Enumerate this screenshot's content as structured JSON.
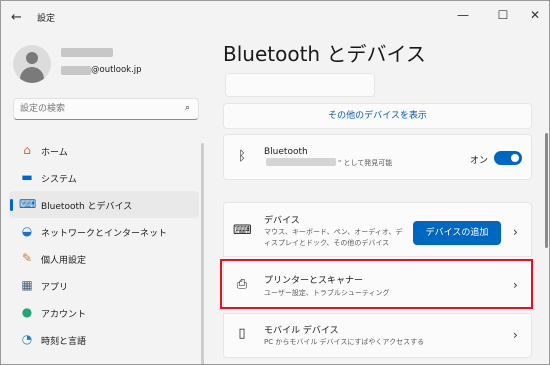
{
  "window": {
    "title": "設定",
    "minimize": "—",
    "maximize": "☐",
    "close": "✕",
    "back": "←"
  },
  "user": {
    "email_suffix": "@outlook.jp"
  },
  "search": {
    "placeholder": "設定の検索"
  },
  "sidebar": {
    "items": [
      {
        "label": "ホーム",
        "icon": "home-icon",
        "color": "#c76b3a",
        "selected": false
      },
      {
        "label": "システム",
        "icon": "system-icon",
        "color": "#0067c0",
        "selected": false
      },
      {
        "label": "Bluetooth とデバイス",
        "icon": "bluetooth-devices-icon",
        "color": "#0067c0",
        "selected": true
      },
      {
        "label": "ネットワークとインターネット",
        "icon": "wifi-icon",
        "color": "#1a73c8",
        "selected": false
      },
      {
        "label": "個人用設定",
        "icon": "brush-icon",
        "color": "#d07a2b",
        "selected": false
      },
      {
        "label": "アプリ",
        "icon": "apps-icon",
        "color": "#4a5b7a",
        "selected": false
      },
      {
        "label": "アカウント",
        "icon": "account-icon",
        "color": "#21a67a",
        "selected": false
      },
      {
        "label": "時刻と言語",
        "icon": "time-language-icon",
        "color": "#1f7fc8",
        "selected": false
      }
    ]
  },
  "main": {
    "title": "Bluetooth とデバイス",
    "more_devices_link": "その他のデバイスを表示",
    "bluetooth": {
      "title": "Bluetooth",
      "subtitle_suffix": "\" として発見可能",
      "toggle_label": "オン",
      "toggle_on": true
    },
    "devices": {
      "title": "デバイス",
      "subtitle": "マウス、キーボード、ペン、オーディオ、ディスプレイとドック、その他のデバイス",
      "add_button": "デバイスの追加"
    },
    "printers": {
      "title": "プリンターとスキャナー",
      "subtitle": "ユーザー設定、トラブルシューティング"
    },
    "mobile": {
      "title": "モバイル デバイス",
      "subtitle": "PC からモバイル デバイスにすばやくアクセスする"
    }
  },
  "accent_color": "#0067c0",
  "highlight_color": "#e0161e"
}
